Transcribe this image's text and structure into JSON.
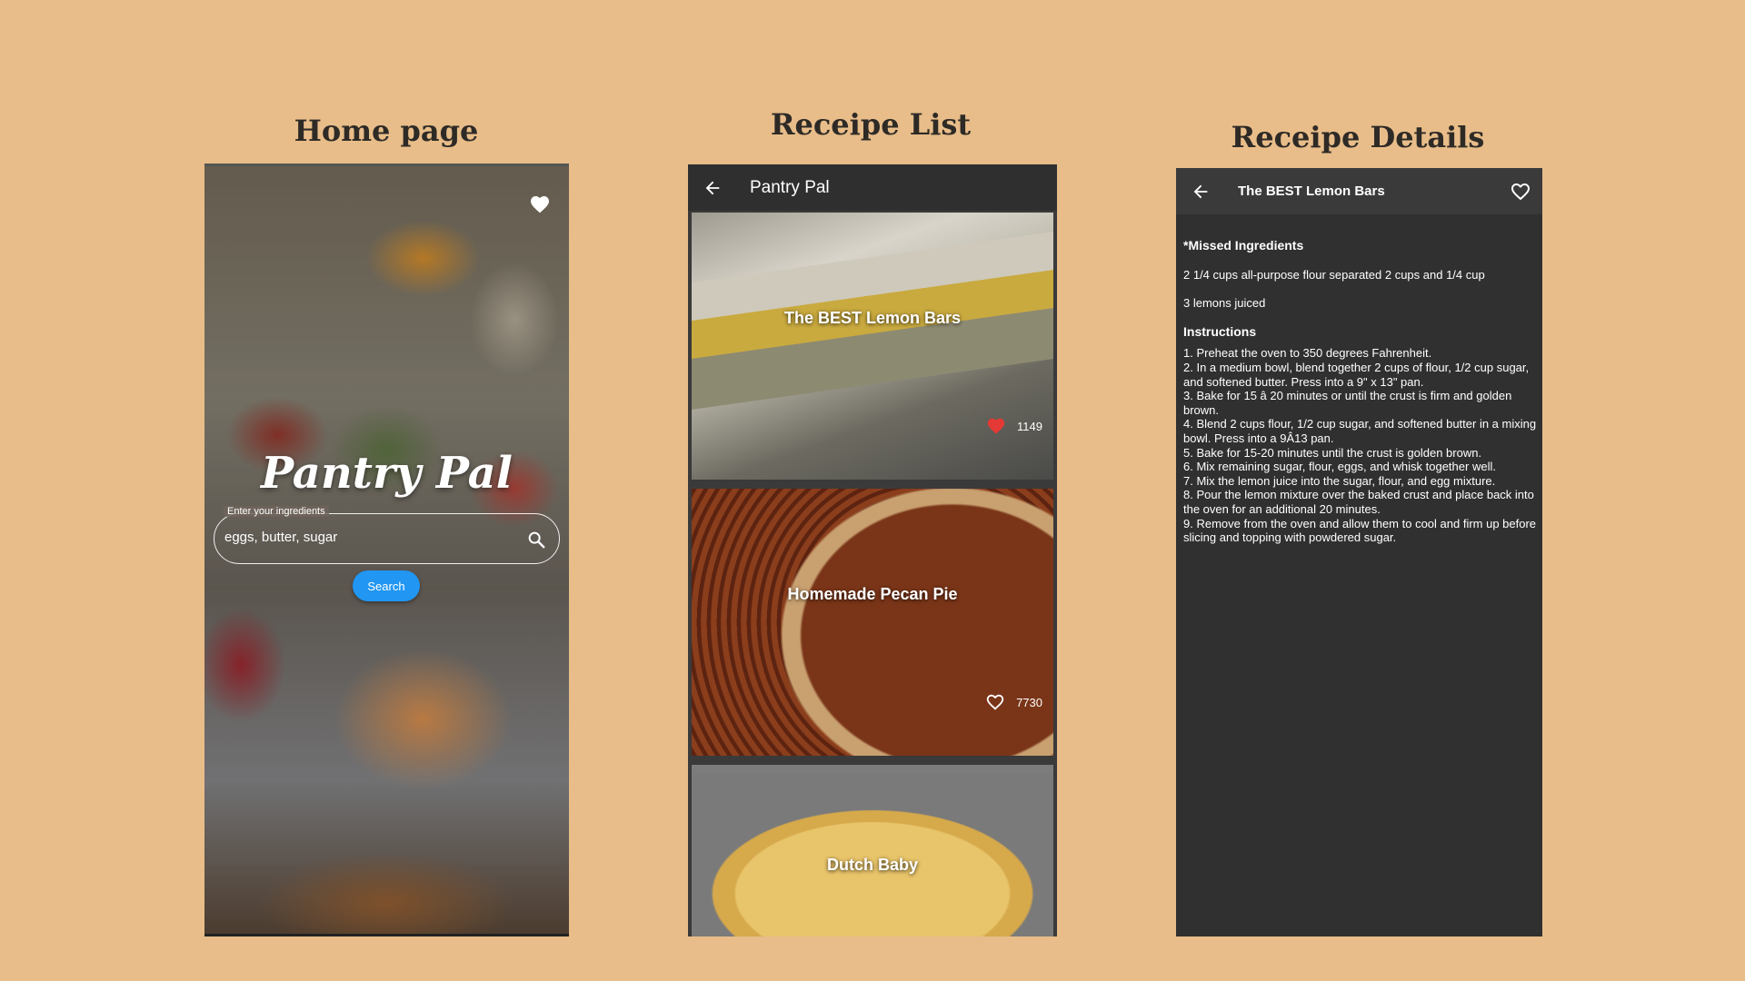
{
  "sections": {
    "home_title": "Home page",
    "list_title": "Receipe List",
    "details_title": "Receipe Details"
  },
  "home": {
    "logo": "Pantry Pal",
    "ingredients_label": "Enter your ingredients",
    "ingredients_value": "eggs, butter, sugar",
    "search_label": "Search",
    "icons": {
      "favorite": "heart-icon",
      "search": "search-icon"
    }
  },
  "list": {
    "app_title": "Pantry Pal",
    "icons": {
      "back": "arrow-back-icon"
    },
    "recipes": [
      {
        "title": "The BEST Lemon Bars",
        "likes": "1149",
        "favorited": true
      },
      {
        "title": "Homemade Pecan Pie",
        "likes": "7730",
        "favorited": false
      },
      {
        "title": "Dutch Baby"
      }
    ],
    "colors": {
      "favorited_heart": "#e53935"
    }
  },
  "details": {
    "title": "The BEST Lemon Bars",
    "missed_heading": "*Missed Ingredients",
    "missed": [
      "2 1/4 cups all-purpose flour separated 2 cups and 1/4 cup",
      "3 lemons juiced"
    ],
    "instructions_heading": "Instructions",
    "steps": [
      "1. Preheat the oven to 350 degrees Fahrenheit.",
      "2. In a medium bowl, blend together 2 cups of flour, 1/2 cup sugar, and softened butter. Press into a 9\" x 13\" pan.",
      "3. Bake for 15 â 20 minutes or until the crust is firm and golden brown.",
      "4. Blend 2 cups flour, 1/2 cup sugar, and softened butter in a mixing bowl. Press into a 9Â13 pan.",
      "5. Bake for 15-20 minutes until the crust is golden brown.",
      "6. Mix remaining sugar, flour, eggs, and whisk together well.",
      "7. Mix the lemon juice into the sugar, flour, and egg mixture.",
      "8. Pour the lemon mixture over the baked crust and place back into the oven for an additional 20 minutes.",
      "9. Remove from the oven and allow them to cool and firm up before slicing and topping with powdered sugar."
    ]
  }
}
